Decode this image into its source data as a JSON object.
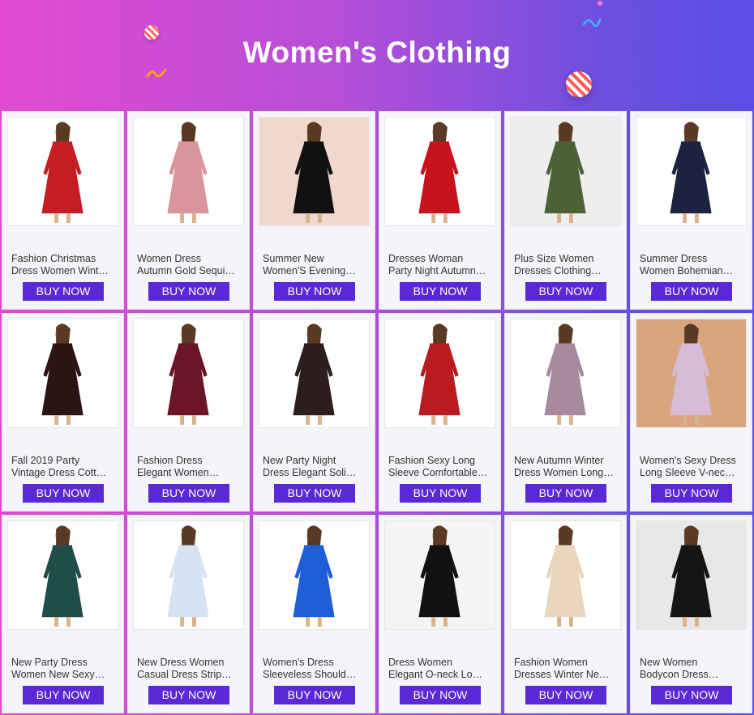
{
  "page": {
    "title": "Women's Clothing"
  },
  "products": [
    {
      "name_line1": "Fashion Christmas",
      "name_line2": "Dress Women Wint…",
      "button": "BUY NOW",
      "color": "#c41d23",
      "bg": "#ffffff"
    },
    {
      "name_line1": "Women Dress",
      "name_line2": "Autumn Gold Sequi…",
      "button": "BUY NOW",
      "color": "#d9949c",
      "bg": "#ffffff"
    },
    {
      "name_line1": "Summer New",
      "name_line2": "Women'S Evening…",
      "button": "BUY NOW",
      "color": "#111111",
      "bg": "#f2d8cc"
    },
    {
      "name_line1": "Dresses Woman",
      "name_line2": "Party Night Autumn…",
      "button": "BUY NOW",
      "color": "#c8121c",
      "bg": "#ffffff"
    },
    {
      "name_line1": "Plus Size Women",
      "name_line2": "Dresses Clothing…",
      "button": "BUY NOW",
      "color": "#4d6136",
      "bg": "#eeeeee"
    },
    {
      "name_line1": "Summer Dress",
      "name_line2": "Women Bohemian…",
      "button": "BUY NOW",
      "color": "#1b2340",
      "bg": "#ffffff"
    },
    {
      "name_line1": "Fall 2019 Party",
      "name_line2": "Vintage Dress Cott…",
      "button": "BUY NOW",
      "color": "#2a1414",
      "bg": "#ffffff"
    },
    {
      "name_line1": "Fashion Dress",
      "name_line2": "Elegant Women…",
      "button": "BUY NOW",
      "color": "#6b1526",
      "bg": "#ffffff"
    },
    {
      "name_line1": "New Party Night",
      "name_line2": "Dress Elegant Soli…",
      "button": "BUY NOW",
      "color": "#2b1e1c",
      "bg": "#ffffff"
    },
    {
      "name_line1": "Fashion Sexy Long",
      "name_line2": "Sleeve Comfortable…",
      "button": "BUY NOW",
      "color": "#b91b20",
      "bg": "#ffffff"
    },
    {
      "name_line1": "New Autumn Winter",
      "name_line2": "Dress Women Long…",
      "button": "BUY NOW",
      "color": "#a88a9e",
      "bg": "#ffffff"
    },
    {
      "name_line1": "Women's Sexy Dress",
      "name_line2": "Long Sleeve V-nec…",
      "button": "BUY NOW",
      "color": "#d6bcd6",
      "bg": "#d8a57f"
    },
    {
      "name_line1": "New Party Dress",
      "name_line2": "Women New Sexy…",
      "button": "BUY NOW",
      "color": "#1f4d4a",
      "bg": "#ffffff"
    },
    {
      "name_line1": "New Dress Women",
      "name_line2": "Casual Dress Strip…",
      "button": "BUY NOW",
      "color": "#d7e2f2",
      "bg": "#ffffff"
    },
    {
      "name_line1": "Women's Dress",
      "name_line2": "Sleeveless Should…",
      "button": "BUY NOW",
      "color": "#1f5ed8",
      "bg": "#ffffff"
    },
    {
      "name_line1": "Dress Women",
      "name_line2": "Elegant O-neck Lo…",
      "button": "BUY NOW",
      "color": "#111111",
      "bg": "#f4f4f4"
    },
    {
      "name_line1": "Fashion Women",
      "name_line2": "Dresses Winter Ne…",
      "button": "BUY NOW",
      "color": "#ead6bd",
      "bg": "#ffffff"
    },
    {
      "name_line1": "New Women",
      "name_line2": "Bodycon Dress…",
      "button": "BUY NOW",
      "color": "#151515",
      "bg": "#e8e8e8"
    }
  ]
}
